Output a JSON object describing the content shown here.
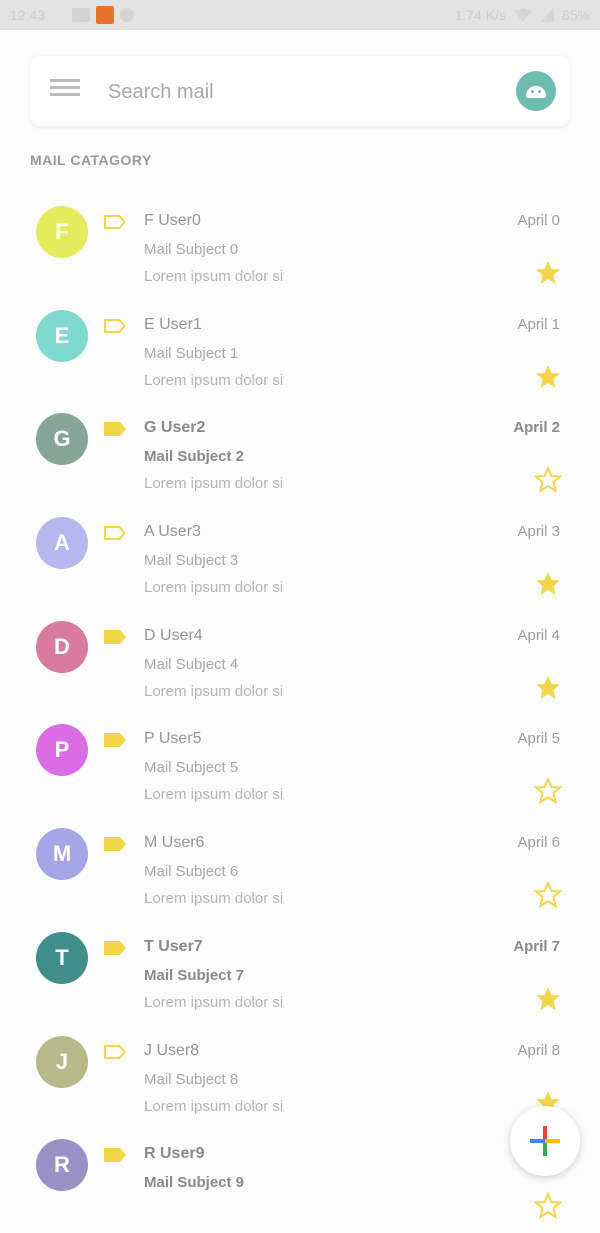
{
  "status_bar": {
    "time": "12:43",
    "right_text": "1.74 K/s",
    "battery": "85%"
  },
  "search": {
    "placeholder": "Search mail"
  },
  "section": {
    "title": "MAIL CATAGORY"
  },
  "colors": {
    "star": "#f2d54b",
    "tag": "#f2d54b"
  },
  "mails": [
    {
      "initial": "F",
      "avatar_color": "#e4ec5e",
      "tag_filled": false,
      "sender": "F User0",
      "subject": "Mail Subject 0",
      "preview": "Lorem ipsum dolor si",
      "date": "April 0",
      "starred": true,
      "unread": false
    },
    {
      "initial": "E",
      "avatar_color": "#7fd9cf",
      "tag_filled": false,
      "sender": "E User1",
      "subject": "Mail Subject 1",
      "preview": "Lorem ipsum dolor si",
      "date": "April 1",
      "starred": true,
      "unread": false
    },
    {
      "initial": "G",
      "avatar_color": "#86a699",
      "tag_filled": true,
      "sender": "G User2",
      "subject": "Mail Subject 2",
      "preview": "Lorem ipsum dolor si",
      "date": "April 2",
      "starred": false,
      "unread": true
    },
    {
      "initial": "A",
      "avatar_color": "#b5b8ee",
      "tag_filled": false,
      "sender": "A User3",
      "subject": "Mail Subject 3",
      "preview": "Lorem ipsum dolor si",
      "date": "April 3",
      "starred": true,
      "unread": false
    },
    {
      "initial": "D",
      "avatar_color": "#d97b9c",
      "tag_filled": true,
      "sender": "D User4",
      "subject": "Mail Subject 4",
      "preview": "Lorem ipsum dolor si",
      "date": "April 4",
      "starred": true,
      "unread": false
    },
    {
      "initial": "P",
      "avatar_color": "#da6ce6",
      "tag_filled": true,
      "sender": "P User5",
      "subject": "Mail Subject 5",
      "preview": "Lorem ipsum dolor si",
      "date": "April 5",
      "starred": false,
      "unread": false
    },
    {
      "initial": "M",
      "avatar_color": "#a4a6e8",
      "tag_filled": true,
      "sender": "M User6",
      "subject": "Mail Subject 6",
      "preview": "Lorem ipsum dolor si",
      "date": "April 6",
      "starred": false,
      "unread": false
    },
    {
      "initial": "T",
      "avatar_color": "#3f8e8c",
      "tag_filled": true,
      "sender": "T User7",
      "subject": "Mail Subject 7",
      "preview": "Lorem ipsum dolor si",
      "date": "April 7",
      "starred": true,
      "unread": true
    },
    {
      "initial": "J",
      "avatar_color": "#b7b98a",
      "tag_filled": false,
      "sender": "J User8",
      "subject": "Mail Subject 8",
      "preview": "Lorem ipsum dolor si",
      "date": "April 8",
      "starred": true,
      "unread": false
    },
    {
      "initial": "R",
      "avatar_color": "#9a92c6",
      "tag_filled": true,
      "sender": "R User9",
      "subject": "Mail Subject 9",
      "preview": "",
      "date": "",
      "starred": false,
      "unread": true
    }
  ],
  "fab": {
    "icon": "plus-icon"
  }
}
